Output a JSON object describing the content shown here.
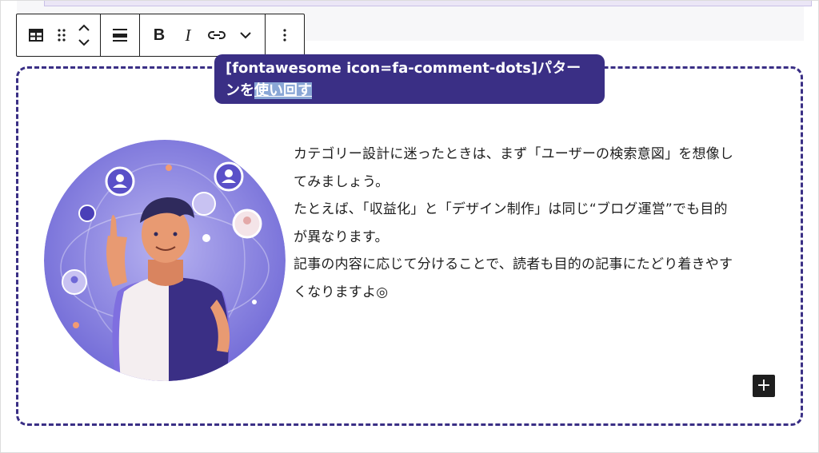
{
  "block_label": {
    "prefix": "[fontawesome icon=fa-comment-dots]パター",
    "line2_start": "ンを",
    "selected": "使い回す"
  },
  "toolbar": {
    "groups": [
      [
        "table-icon",
        "drag-handle-icon",
        "move-up-down-icon"
      ],
      [
        "align-icon"
      ],
      [
        "bold-icon",
        "italic-icon",
        "link-icon",
        "chevron-down-icon"
      ],
      [
        "more-options-icon"
      ]
    ],
    "bold_label": "B",
    "italic_label": "I"
  },
  "content": {
    "paragraph": "カテゴリー設計に迷ったときは、まず「ユーザーの検索意図」を想像してみましょう。\nたとえば、「収益化」と「デザイン制作」は同じ“ブログ運営”でも目的が異なります。\n記事の内容に応じて分けることで、読者も目的の記事にたどり着きやすくなりますよ◎",
    "lines": [
      "カテゴリー設計に迷ったときは、まず「ユーザーの検索意図」を想像し",
      "てみましょう。",
      "たとえば、「収益化」と「デザイン制作」は同じ“ブログ運営”でも目的",
      "が異なります。",
      "記事の内容に応じて分けることで、読者も目的の記事にたどり着きやす",
      "くなりますよ◎"
    ],
    "add_button": "+"
  },
  "colors": {
    "accent": "#3a2f85",
    "selection": "#8aa7d6",
    "text": "#1e1e1e"
  }
}
